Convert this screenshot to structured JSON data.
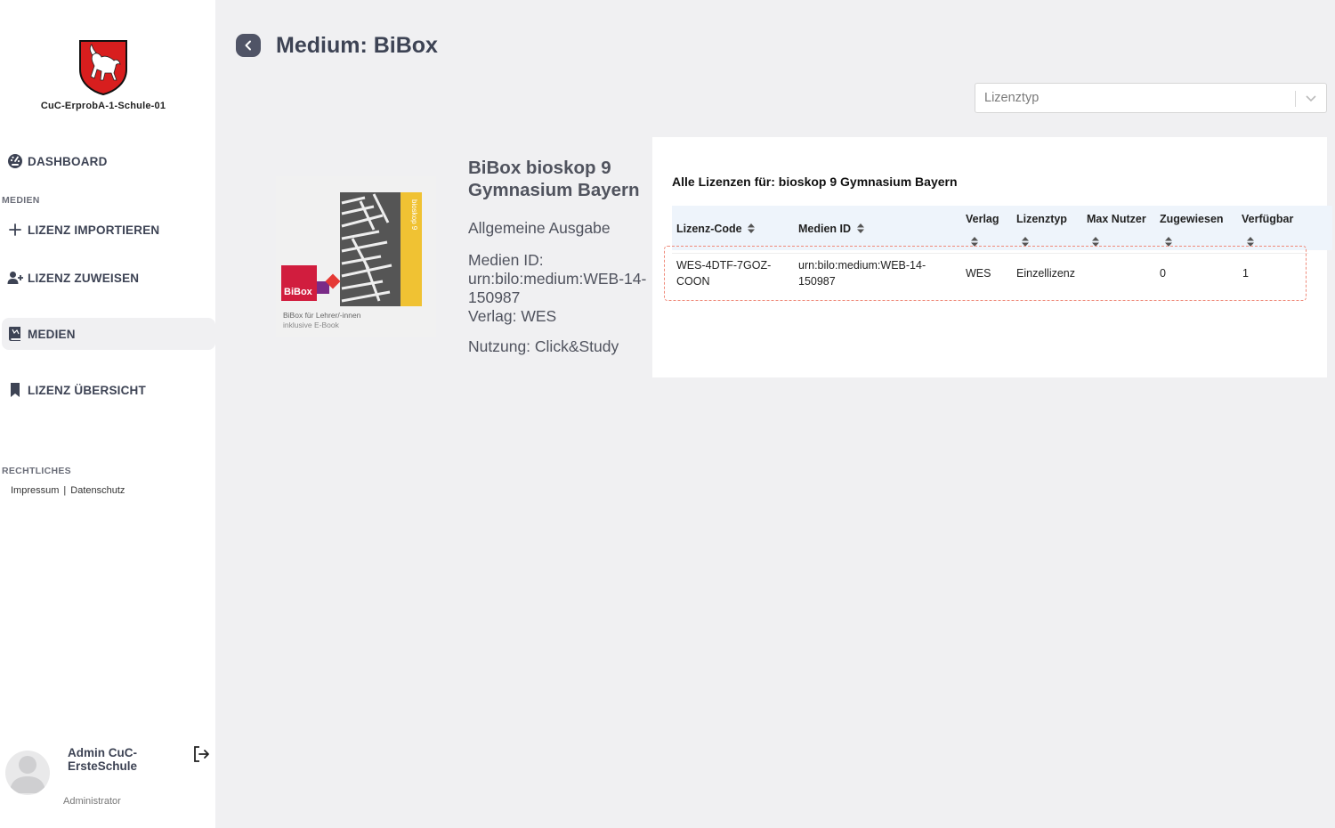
{
  "sidebar": {
    "school_name": "CuC-ErprobA-1-Schule-01",
    "nav": {
      "dashboard": "DASHBOARD",
      "section_medien": "MEDIEN",
      "lizenz_importieren": "LIZENZ IMPORTIEREN",
      "lizenz_zuweisen": "LIZENZ ZUWEISEN",
      "medien": "MEDIEN",
      "lizenz_uebersicht": "LIZENZ ÜBERSICHT",
      "section_rechtliches": "RECHTLICHES"
    },
    "legal": {
      "impressum": "Impressum",
      "separator": "|",
      "datenschutz": "Datenschutz"
    },
    "user": {
      "name": "Admin CuC-ErsteSchule",
      "role": "Administrator"
    }
  },
  "header": {
    "title": "Medium: BiBox"
  },
  "filter": {
    "placeholder": "Lizenztyp"
  },
  "media": {
    "title": "BiBox bioskop 9 Gymnasium Bayern",
    "edition": "Allgemeine Ausgabe",
    "medien_id_label": "Medien ID:",
    "medien_id": "urn:bilo:medium:WEB-14-150987",
    "verlag": "Verlag: WES",
    "nutzung": "Nutzung: Click&Study",
    "cover": {
      "brand": "BiBox",
      "series": "bioskop 9",
      "caption_1": "BiBox für Lehrer/-innen",
      "caption_2": "inklusive E-Book"
    }
  },
  "licenses": {
    "title": "Alle Lizenzen für: bioskop 9 Gymnasium Bayern",
    "columns": [
      "Lizenz-Code",
      "Medien ID",
      "Verlag",
      "Lizenztyp",
      "Max Nutzer",
      "Zugewiesen",
      "Verfügbar"
    ],
    "rows": [
      {
        "lizenz_code": "WES-4DTF-7GOZ-COON",
        "medien_id": "urn:bilo:medium:WEB-14-150987",
        "verlag": "WES",
        "lizenztyp": "Einzellizenz",
        "max_nutzer": "",
        "zugewiesen": "0",
        "verfuegbar": "1"
      }
    ]
  },
  "colors": {
    "accent_dark": "#505466",
    "highlight_dashed": "#ef8a7a",
    "table_header_bg": "#eef4fb",
    "logo_red": "#d81e1e"
  }
}
